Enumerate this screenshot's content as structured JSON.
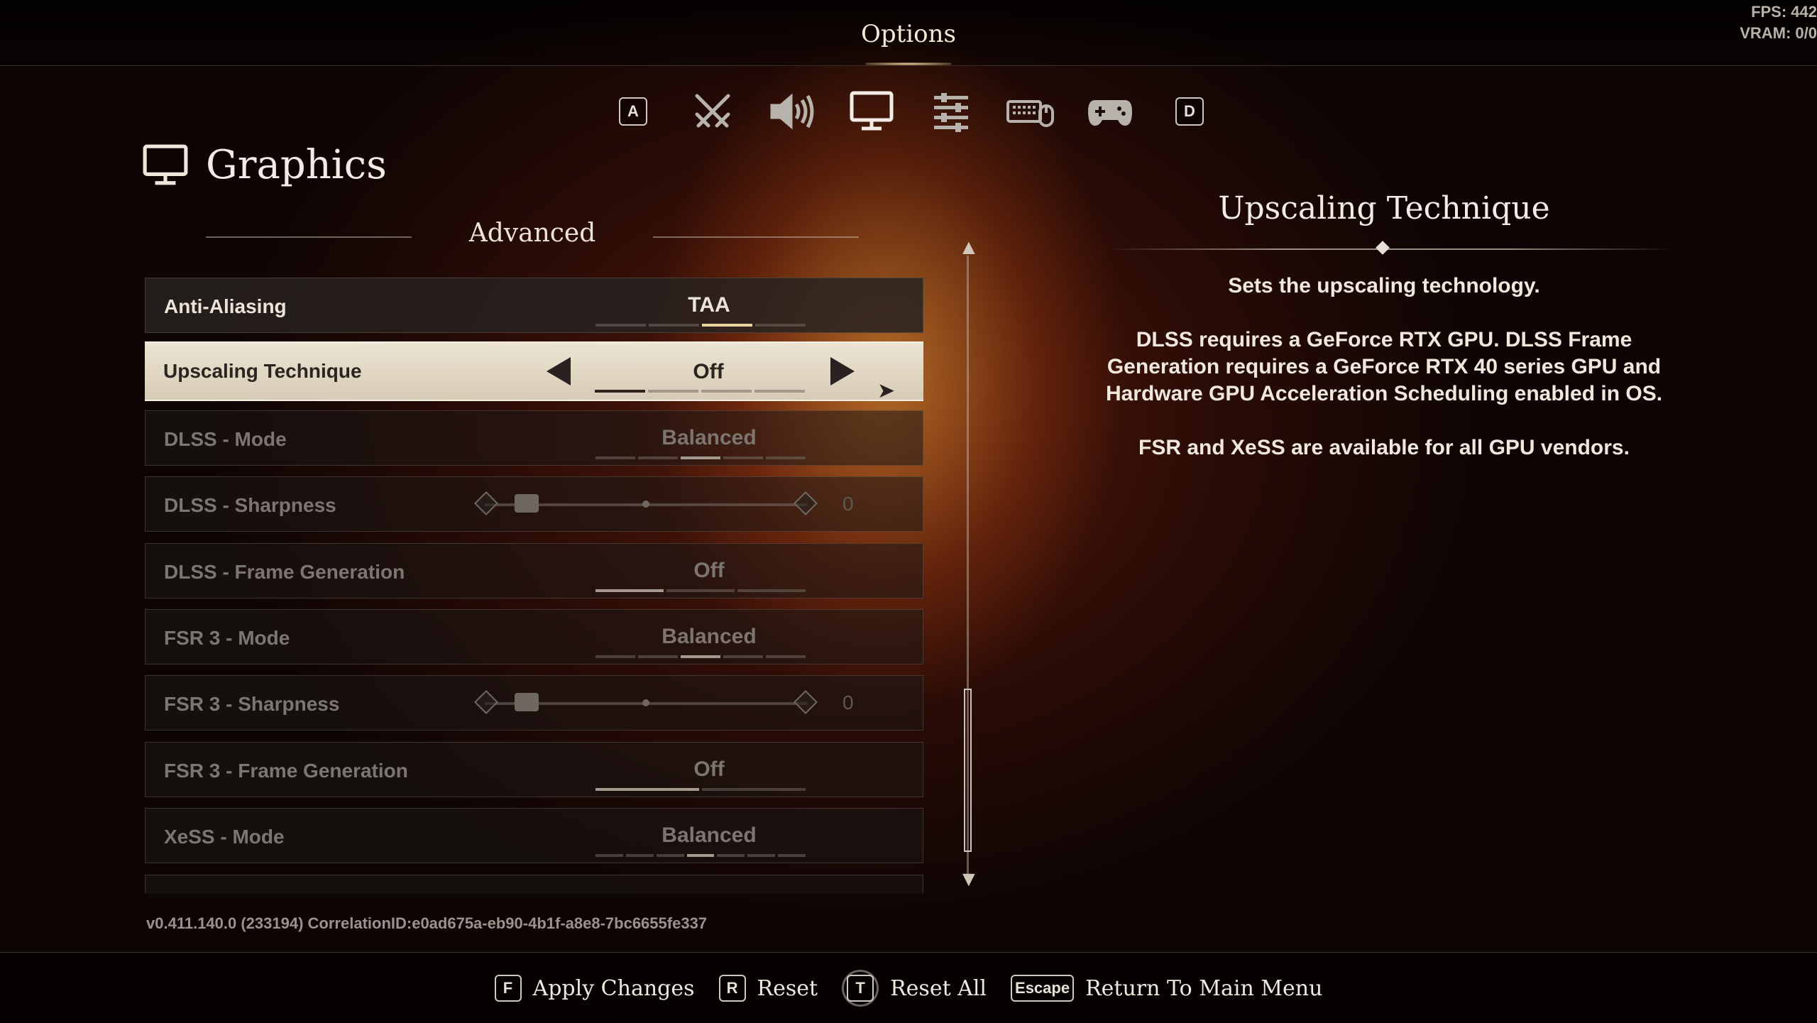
{
  "header": {
    "title": "Options",
    "fps": "FPS: 442",
    "vram": "VRAM: 0/0"
  },
  "tabs": [
    {
      "key": "A",
      "icon": "key-a-icon"
    },
    {
      "icon": "crossed-swords-icon"
    },
    {
      "icon": "speaker-icon"
    },
    {
      "icon": "monitor-icon",
      "active": true
    },
    {
      "icon": "sliders-icon"
    },
    {
      "icon": "keyboard-mouse-icon"
    },
    {
      "icon": "gamepad-icon"
    },
    {
      "key": "D",
      "icon": "key-d-icon"
    }
  ],
  "page": {
    "title": "Graphics",
    "section": "Advanced"
  },
  "settings": [
    {
      "label": "Anti-Aliasing",
      "value": "TAA",
      "kind": "selector",
      "state": "enabled",
      "segments": 4,
      "active_segment": 3
    },
    {
      "label": "Upscaling Technique",
      "value": "Off",
      "kind": "selector",
      "state": "selected",
      "segments": 4,
      "active_segment": 1
    },
    {
      "label": "DLSS - Mode",
      "value": "Balanced",
      "kind": "selector",
      "state": "disabled",
      "segments": 5,
      "active_segment": 3
    },
    {
      "label": "DLSS - Sharpness",
      "value": "0",
      "kind": "slider",
      "state": "disabled"
    },
    {
      "label": "DLSS - Frame Generation",
      "value": "Off",
      "kind": "selector",
      "state": "disabled",
      "segments": 3,
      "active_segment": 1
    },
    {
      "label": "FSR 3 - Mode",
      "value": "Balanced",
      "kind": "selector",
      "state": "disabled",
      "segments": 5,
      "active_segment": 3
    },
    {
      "label": "FSR 3 - Sharpness",
      "value": "0",
      "kind": "slider",
      "state": "disabled"
    },
    {
      "label": "FSR 3 - Frame Generation",
      "value": "Off",
      "kind": "selector",
      "state": "disabled",
      "segments": 2,
      "active_segment": 1
    },
    {
      "label": "XeSS - Mode",
      "value": "Balanced",
      "kind": "selector",
      "state": "disabled",
      "segments": 7,
      "active_segment": 4
    }
  ],
  "detail": {
    "title": "Upscaling Technique",
    "line1": "Sets the upscaling technology.",
    "line2": "DLSS requires a GeForce RTX GPU. DLSS Frame Generation requires a GeForce RTX 40 series GPU and Hardware GPU Acceleration Scheduling enabled in OS.",
    "line3": "FSR and XeSS are available for all GPU vendors."
  },
  "version": "v0.411.140.0 (233194) CorrelationID:e0ad675a-eb90-4b1f-a8e8-7bc6655fe337",
  "hints": [
    {
      "key": "F",
      "label": "Apply Changes"
    },
    {
      "key": "R",
      "label": "Reset"
    },
    {
      "key": "T",
      "label": "Reset All"
    },
    {
      "key": "Escape",
      "label": "Return To Main Menu"
    }
  ]
}
